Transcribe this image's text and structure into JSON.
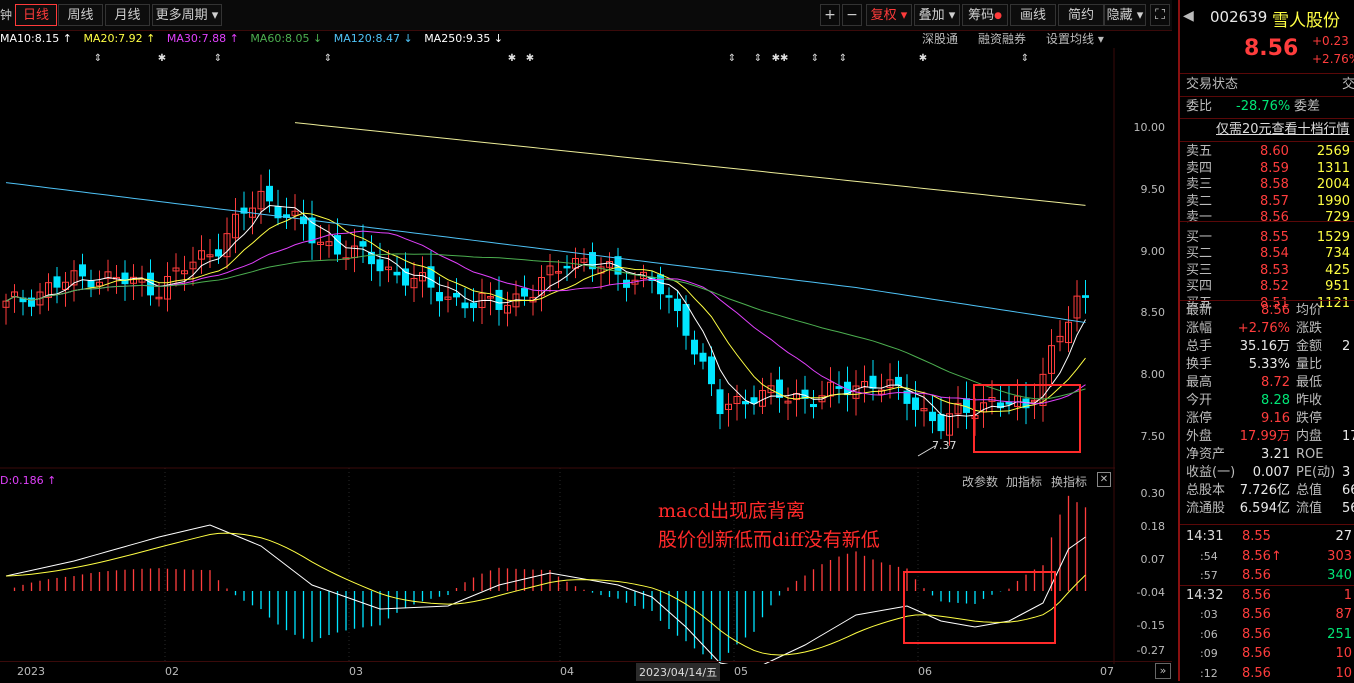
{
  "toolbar": {
    "left_partial": "钟",
    "periods": [
      "日线",
      "周线",
      "月线",
      "更多周期"
    ],
    "plus": "+",
    "minus": "−",
    "buttons": [
      "复权",
      "叠加",
      "筹码",
      "画线",
      "简约",
      "隐藏"
    ]
  },
  "ma_bar": {
    "items": [
      {
        "text": "MA10:8.15 ↑",
        "color": "#ffffff"
      },
      {
        "text": "MA20:7.92 ↑",
        "color": "#ffff44"
      },
      {
        "text": "MA30:7.88 ↑",
        "color": "#e040fb"
      },
      {
        "text": "MA60:8.05 ↓",
        "color": "#4caf50"
      },
      {
        "text": "MA120:8.47 ↓",
        "color": "#4fc3f7"
      },
      {
        "text": "MA250:9.35 ↓",
        "color": "#ffffff"
      }
    ],
    "tools": [
      "深股通",
      "融资融券",
      "设置均线 ▾"
    ]
  },
  "price_axis": [
    "10.00",
    "9.50",
    "9.00",
    "8.50",
    "8.00",
    "7.50"
  ],
  "low_label": "7.37",
  "macd": {
    "header": "D:0.186 ↑",
    "tools": [
      "改参数",
      "加指标",
      "换指标"
    ],
    "close": "✕",
    "axis": [
      "0.30",
      "0.18",
      "0.07",
      "-0.04",
      "-0.15",
      "-0.27"
    ]
  },
  "annotation": {
    "line1": "macd出现底背离",
    "line2": "股价创新低而diff没有新低"
  },
  "x_axis": {
    "labels": [
      "2023",
      "02",
      "03",
      "04",
      "05",
      "06",
      "07"
    ],
    "cursor_date": "2023/04/14/五",
    "next": "»"
  },
  "quote": {
    "code": "002639",
    "name": "雪人股份",
    "price": "8.56",
    "change": "+0.23",
    "change_pct": "+2.76%",
    "status_label": "交易状态",
    "status_partial": "交",
    "weibi_label": "委比",
    "weibi": "-28.76%",
    "weicha_label": "委差",
    "promo": "仅需20元查看十档行情",
    "sells": [
      {
        "label": "卖五",
        "price": "8.60",
        "vol": "2569"
      },
      {
        "label": "卖四",
        "price": "8.59",
        "vol": "1311"
      },
      {
        "label": "卖三",
        "price": "8.58",
        "vol": "2004"
      },
      {
        "label": "卖二",
        "price": "8.57",
        "vol": "1990"
      },
      {
        "label": "卖一",
        "price": "8.56",
        "vol": "729"
      }
    ],
    "buys": [
      {
        "label": "买一",
        "price": "8.55",
        "vol": "1529"
      },
      {
        "label": "买二",
        "price": "8.54",
        "vol": "734"
      },
      {
        "label": "买三",
        "price": "8.53",
        "vol": "425"
      },
      {
        "label": "买四",
        "price": "8.52",
        "vol": "951"
      },
      {
        "label": "买五",
        "price": "8.51",
        "vol": "1121"
      }
    ],
    "stats": [
      {
        "l": "最新",
        "v": "8.56",
        "c": "red",
        "l2": "均价"
      },
      {
        "l": "涨幅",
        "v": "+2.76%",
        "c": "red",
        "l2": "涨跌"
      },
      {
        "l": "总手",
        "v": "35.16万",
        "c": "white",
        "l2": "金额",
        "v2": "2"
      },
      {
        "l": "换手",
        "v": "5.33%",
        "c": "white",
        "l2": "量比"
      },
      {
        "l": "最高",
        "v": "8.72",
        "c": "red",
        "l2": "最低"
      },
      {
        "l": "今开",
        "v": "8.28",
        "c": "green",
        "l2": "昨收"
      },
      {
        "l": "涨停",
        "v": "9.16",
        "c": "red",
        "l2": "跌停"
      },
      {
        "l": "外盘",
        "v": "17.99万",
        "c": "red",
        "l2": "内盘",
        "v2": "17"
      },
      {
        "l": "净资产",
        "v": "3.21",
        "c": "white",
        "l2": "ROE"
      },
      {
        "l": "收益(一)",
        "v": "0.007",
        "c": "white",
        "l2": "PE(动)",
        "v2": "3"
      },
      {
        "l": "总股本",
        "v": "7.726亿",
        "c": "white",
        "l2": "总值",
        "v2": "66"
      },
      {
        "l": "流通股",
        "v": "6.594亿",
        "c": "white",
        "l2": "流值",
        "v2": "56"
      }
    ],
    "ticks": [
      {
        "t": "14:31",
        "p": "8.55",
        "v": "27",
        "vc": "white"
      },
      {
        "t": ":54",
        "p": "8.56↑",
        "v": "303",
        "vc": "red"
      },
      {
        "t": ":57",
        "p": "8.56",
        "v": "340",
        "vc": "green"
      },
      {
        "t": "14:32",
        "p": "8.56",
        "v": "1",
        "vc": "red"
      },
      {
        "t": ":03",
        "p": "8.56",
        "v": "87",
        "vc": "red"
      },
      {
        "t": ":06",
        "p": "8.56",
        "v": "251",
        "vc": "green"
      },
      {
        "t": ":09",
        "p": "8.56",
        "v": "10",
        "vc": "red"
      },
      {
        "t": ":12",
        "p": "8.56",
        "v": "10",
        "vc": "red"
      }
    ]
  },
  "colors": {
    "up": "#ff3d3d",
    "down": "#00e5ff",
    "accent": "#ff2a2a"
  }
}
